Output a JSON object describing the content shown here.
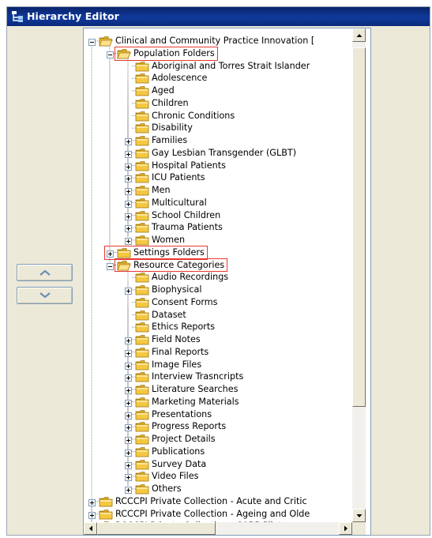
{
  "window": {
    "title": "Hierarchy Editor",
    "icon": "tree-hierarchy-icon"
  },
  "buttons": {
    "move_up": "chevron-up-icon",
    "move_down": "chevron-down-icon"
  },
  "tree": {
    "nodes": [
      {
        "label": "Clinical and Community Practice Innovation [",
        "level": 0,
        "toggle": "minus",
        "folder": "open"
      },
      {
        "label": "Population Folders",
        "level": 1,
        "toggle": "minus",
        "folder": "open",
        "highlight": true
      },
      {
        "label": "Aboriginal and Torres Strait Islander",
        "level": 2,
        "toggle": "none",
        "folder": "closed"
      },
      {
        "label": "Adolescence",
        "level": 2,
        "toggle": "none",
        "folder": "closed"
      },
      {
        "label": "Aged",
        "level": 2,
        "toggle": "none",
        "folder": "closed"
      },
      {
        "label": "Children",
        "level": 2,
        "toggle": "none",
        "folder": "closed"
      },
      {
        "label": "Chronic Conditions",
        "level": 2,
        "toggle": "none",
        "folder": "closed"
      },
      {
        "label": "Disability",
        "level": 2,
        "toggle": "none",
        "folder": "closed"
      },
      {
        "label": "Families",
        "level": 2,
        "toggle": "plus",
        "folder": "closed"
      },
      {
        "label": "Gay Lesbian Transgender (GLBT)",
        "level": 2,
        "toggle": "plus",
        "folder": "closed"
      },
      {
        "label": "Hospital Patients",
        "level": 2,
        "toggle": "plus",
        "folder": "closed"
      },
      {
        "label": "ICU Patients",
        "level": 2,
        "toggle": "plus",
        "folder": "closed"
      },
      {
        "label": "Men",
        "level": 2,
        "toggle": "plus",
        "folder": "closed"
      },
      {
        "label": "Multicultural",
        "level": 2,
        "toggle": "plus",
        "folder": "closed"
      },
      {
        "label": "School Children",
        "level": 2,
        "toggle": "plus",
        "folder": "closed"
      },
      {
        "label": "Trauma Patients",
        "level": 2,
        "toggle": "plus",
        "folder": "closed"
      },
      {
        "label": "Women",
        "level": 2,
        "toggle": "plus",
        "folder": "closed"
      },
      {
        "label": "Settings Folders",
        "level": 1,
        "toggle": "plus",
        "folder": "closed",
        "highlight": true
      },
      {
        "label": "Resource Categories",
        "level": 1,
        "toggle": "minus",
        "folder": "open",
        "highlight": true
      },
      {
        "label": "Audio Recordings",
        "level": 2,
        "toggle": "none",
        "folder": "closed"
      },
      {
        "label": "Biophysical",
        "level": 2,
        "toggle": "plus",
        "folder": "closed"
      },
      {
        "label": "Consent Forms",
        "level": 2,
        "toggle": "none",
        "folder": "closed"
      },
      {
        "label": "Dataset",
        "level": 2,
        "toggle": "none",
        "folder": "closed"
      },
      {
        "label": "Ethics Reports",
        "level": 2,
        "toggle": "none",
        "folder": "closed"
      },
      {
        "label": "Field Notes",
        "level": 2,
        "toggle": "plus",
        "folder": "closed"
      },
      {
        "label": "Final Reports",
        "level": 2,
        "toggle": "plus",
        "folder": "closed"
      },
      {
        "label": "Image Files",
        "level": 2,
        "toggle": "plus",
        "folder": "closed"
      },
      {
        "label": "Interview Trasncripts",
        "level": 2,
        "toggle": "plus",
        "folder": "closed"
      },
      {
        "label": "Literature Searches",
        "level": 2,
        "toggle": "plus",
        "folder": "closed"
      },
      {
        "label": "Marketing Materials",
        "level": 2,
        "toggle": "plus",
        "folder": "closed"
      },
      {
        "label": "Presentations",
        "level": 2,
        "toggle": "plus",
        "folder": "closed"
      },
      {
        "label": "Progress Reports",
        "level": 2,
        "toggle": "plus",
        "folder": "closed"
      },
      {
        "label": "Project Details",
        "level": 2,
        "toggle": "plus",
        "folder": "closed"
      },
      {
        "label": "Publications",
        "level": 2,
        "toggle": "plus",
        "folder": "closed"
      },
      {
        "label": "Survey Data",
        "level": 2,
        "toggle": "plus",
        "folder": "closed"
      },
      {
        "label": "Video Files",
        "level": 2,
        "toggle": "plus",
        "folder": "closed"
      },
      {
        "label": "Others",
        "level": 2,
        "toggle": "plus",
        "folder": "closed"
      },
      {
        "label": "RCCCPI Private Collection - Acute and Critic",
        "level": 0,
        "toggle": "plus",
        "folder": "closed"
      },
      {
        "label": "RCCCPI Private Collection - Ageing and Olde",
        "level": 0,
        "toggle": "plus",
        "folder": "closed"
      },
      {
        "label": "RCCCPI Private Collection - CARP Pilot",
        "level": 0,
        "toggle": "plus",
        "folder": "closed"
      }
    ]
  },
  "scrollbars": {
    "vertical_position": 0.05,
    "horizontal_position": 0.0
  },
  "colors": {
    "title_bar": "#0a246a",
    "highlight_box": "#e8382f",
    "folder": "#f5c842",
    "window_bg": "#ece9d8"
  }
}
